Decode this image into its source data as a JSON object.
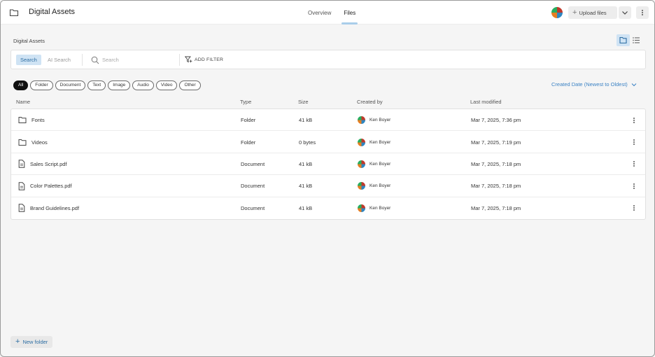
{
  "header": {
    "title": "Digital Assets",
    "tabs": [
      {
        "label": "Overview",
        "active": false
      },
      {
        "label": "Files",
        "active": true
      }
    ],
    "upload_label": "Upload files"
  },
  "breadcrumb": "Digital Assets",
  "filterbar": {
    "search_tab": "Search",
    "ai_search_tab": "AI Search",
    "search_placeholder": "Search",
    "add_filter_label": "ADD FILTER"
  },
  "chips": [
    "All",
    "Folder",
    "Document",
    "Text",
    "Image",
    "Audio",
    "Video",
    "Other"
  ],
  "sort_label": "Created Date (Newest to Oldest)",
  "columns": {
    "name": "Name",
    "type": "Type",
    "size": "Size",
    "created_by": "Created by",
    "last_modified": "Last modified"
  },
  "rows": [
    {
      "icon": "folder-icon",
      "name": "Fonts",
      "type": "Folder",
      "size": "41 kB",
      "created_by": "Ken Boyer",
      "modified": "Mar 7, 2025, 7:36 pm"
    },
    {
      "icon": "folder-icon",
      "name": "Videos",
      "type": "Folder",
      "size": "0 bytes",
      "created_by": "Ken Boyer",
      "modified": "Mar 7, 2025, 7:19 pm"
    },
    {
      "icon": "document-icon",
      "name": "Sales Script.pdf",
      "type": "Document",
      "size": "41 kB",
      "created_by": "Ken Boyer",
      "modified": "Mar 7, 2025, 7:18 pm"
    },
    {
      "icon": "document-icon",
      "name": "Color Palettes.pdf",
      "type": "Document",
      "size": "41 kB",
      "created_by": "Ken Boyer",
      "modified": "Mar 7, 2025, 7:18 pm"
    },
    {
      "icon": "document-icon",
      "name": "Brand Guidelines.pdf",
      "type": "Document",
      "size": "41 kB",
      "created_by": "Ken Boyer",
      "modified": "Mar 7, 2025, 7:18 pm"
    }
  ],
  "new_folder_label": "New folder",
  "colors": {
    "accent": "#3b82c4",
    "accent_light": "#cfe3f4",
    "chip_active": "#111111"
  }
}
